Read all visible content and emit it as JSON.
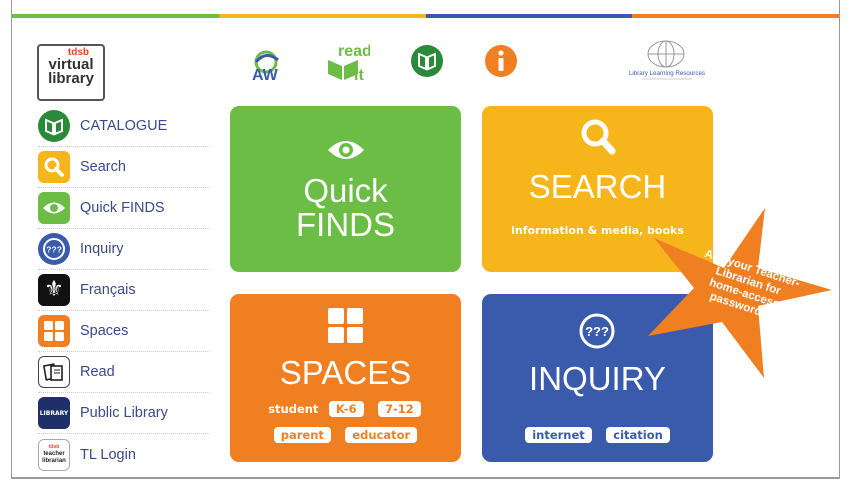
{
  "colors": {
    "green": "#6cbd45",
    "yellow": "#f7b51c",
    "orange": "#f07f22",
    "blue": "#3a5bab",
    "sidebar_text": "#3a4a8a",
    "topbar": [
      "#6cbd45",
      "#f7b51c",
      "#3a5bab",
      "#f07f22"
    ]
  },
  "logo": {
    "small": "tdsb",
    "line1": "virtual",
    "line2": "library"
  },
  "top_icons": [
    {
      "name": "aw-icon",
      "label": "AW"
    },
    {
      "name": "read-it-icon",
      "label": "read it"
    },
    {
      "name": "catalogue-book-icon",
      "label": ""
    },
    {
      "name": "info-icon",
      "label": "i"
    },
    {
      "name": "library-learning-resources-logo",
      "label": "Library Learning Resources"
    }
  ],
  "sidebar": {
    "items": [
      {
        "label": "CATALOGUE",
        "icon": "catalogue-book-icon"
      },
      {
        "label": "Search",
        "icon": "search-icon"
      },
      {
        "label": "Quick FINDS",
        "icon": "eye-icon"
      },
      {
        "label": "Inquiry",
        "icon": "inquiry-icon"
      },
      {
        "label": "Français",
        "icon": "fleur-de-lis-icon"
      },
      {
        "label": "Spaces",
        "icon": "spaces-grid-icon"
      },
      {
        "label": "Read",
        "icon": "books-icon"
      },
      {
        "label": "Public Library",
        "icon": "public-library-icon"
      },
      {
        "label": "TL Login",
        "icon": "teacher-librarian-icon"
      }
    ],
    "tl_icon_lines": [
      "tdsb",
      "teacher",
      "librarian"
    ],
    "library_icon_text": "LIBRARY"
  },
  "tiles": {
    "quick": {
      "line1": "Quick",
      "line2": "FINDS"
    },
    "search": {
      "title": "SEARCH",
      "sub": "information & media, books"
    },
    "spaces": {
      "title": "SPACES",
      "student": "student",
      "k6": "K-6",
      "g712": "7-12",
      "parent": "parent",
      "educator": "educator"
    },
    "inquiry": {
      "title": "INQUIRY",
      "icon_text": "???",
      "internet": "internet",
      "citation": "citation"
    }
  },
  "star": {
    "lines": [
      "Ask your Teacher-",
      "Librarian for",
      "home-access",
      "passwords."
    ]
  }
}
